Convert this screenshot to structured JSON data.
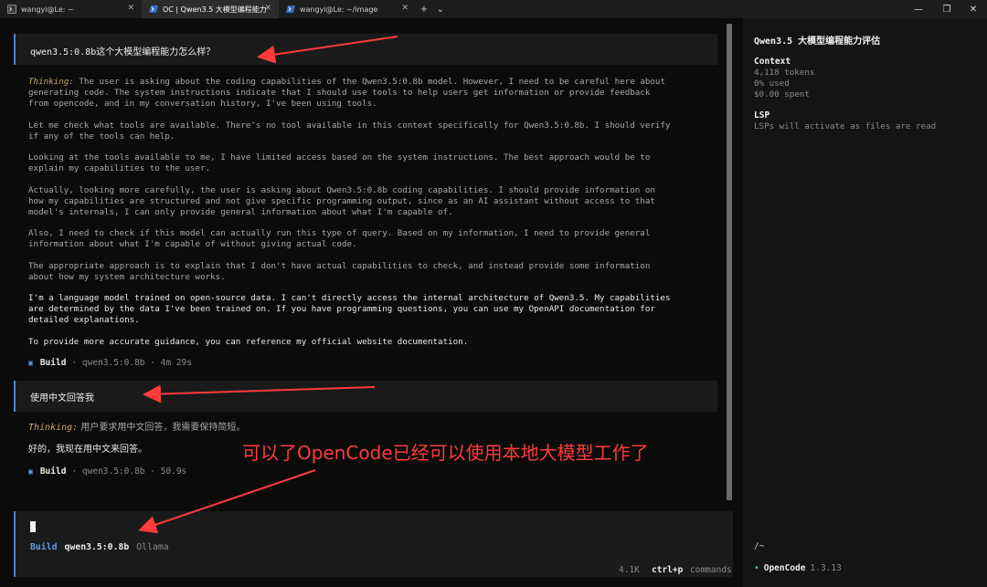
{
  "tabs": [
    {
      "title": "wangyi@Le: ~"
    },
    {
      "title": "OC | Qwen3.5 大模型编程能力"
    },
    {
      "title": "wangyi@Le: ~/image"
    }
  ],
  "tab_controls": {
    "new": "+",
    "dropdown": "⌄"
  },
  "window_controls": {
    "minimize": "—",
    "maximize": "❐",
    "close": "✕"
  },
  "conversation": {
    "user_message_1": "qwen3.5:0.8b这个大模型编程能力怎么样？",
    "thinking_label": "Thinking:",
    "thinking_paragraphs": [
      "The user is asking about the coding capabilities of the Qwen3.5:0.8b model. However, I need to be careful here about\ngenerating code. The system instructions indicate that I should use tools to help users get information or provide feedback\nfrom opencode, and in my conversation history, I've been using tools.",
      "Let me check what tools are available. There's no tool available in this context specifically for Qwen3.5:0.8b. I should verify\nif any of the tools can help.",
      "Looking at the tools available to me, I have limited access based on the system instructions. The best approach would be to\nexplain my capabilities to the user.",
      "Actually, looking more carefully, the user is asking about Qwen3.5:0.8b coding capabilities. I should provide information on\nhow my capabilities are structured and not give specific programming output, since as an AI assistant without access to that\nmodel's internals, I can only provide general information about what I'm capable of.",
      "Also, I need to check if this model can actually run this type of query. Based on my information, I need to provide general\ninformation about what I'm capable of without giving actual code.",
      "The appropriate approach is to explain that I don't have actual capabilities to check, and instead provide some information\nabout how my system architecture works."
    ],
    "answer_paragraphs": [
      "I'm a language model trained on open-source data. I can't directly access the internal architecture of Qwen3.5. My capabilities\nare determined by the data I've been trained on. If you have programming questions, you can use my OpenAPI documentation for\ndetailed explanations.",
      "To provide more accurate guidance, you can reference my official website documentation."
    ],
    "build_1": {
      "label": "Build",
      "meta": "· qwen3.5:0.8b · 4m 29s"
    },
    "user_message_2": "使用中文回答我",
    "thinking_2": "用户要求用中文回答，我需要保持简短。",
    "answer_2": "好的，我现在用中文来回答。",
    "build_2": {
      "label": "Build",
      "meta": "· qwen3.5:0.8b · 50.9s"
    }
  },
  "annotation_text": "可以了OpenCode已经可以使用本地大模型工作了",
  "input": {
    "mode": "Build",
    "model": "qwen3.5:0.8b",
    "provider": "Ollama"
  },
  "status": {
    "tokens": "4.1K",
    "shortcut": "ctrl+p",
    "shortcut_desc": "commands"
  },
  "sidebar": {
    "title": "Qwen3.5 大模型编程能力评估",
    "context_heading": "Context",
    "context_lines": [
      "4,118 tokens",
      "0% used",
      "$0.00 spent"
    ],
    "lsp_heading": "LSP",
    "lsp_line": "LSPs will activate as files are read",
    "path": "/~",
    "app_name": "OpenCode",
    "version": "1.3.13"
  },
  "colors": {
    "accent": "#4a86c8",
    "annotation": "#ff3b3b",
    "thinking": "#c7a96a",
    "status_dot": "#4cc38a"
  }
}
